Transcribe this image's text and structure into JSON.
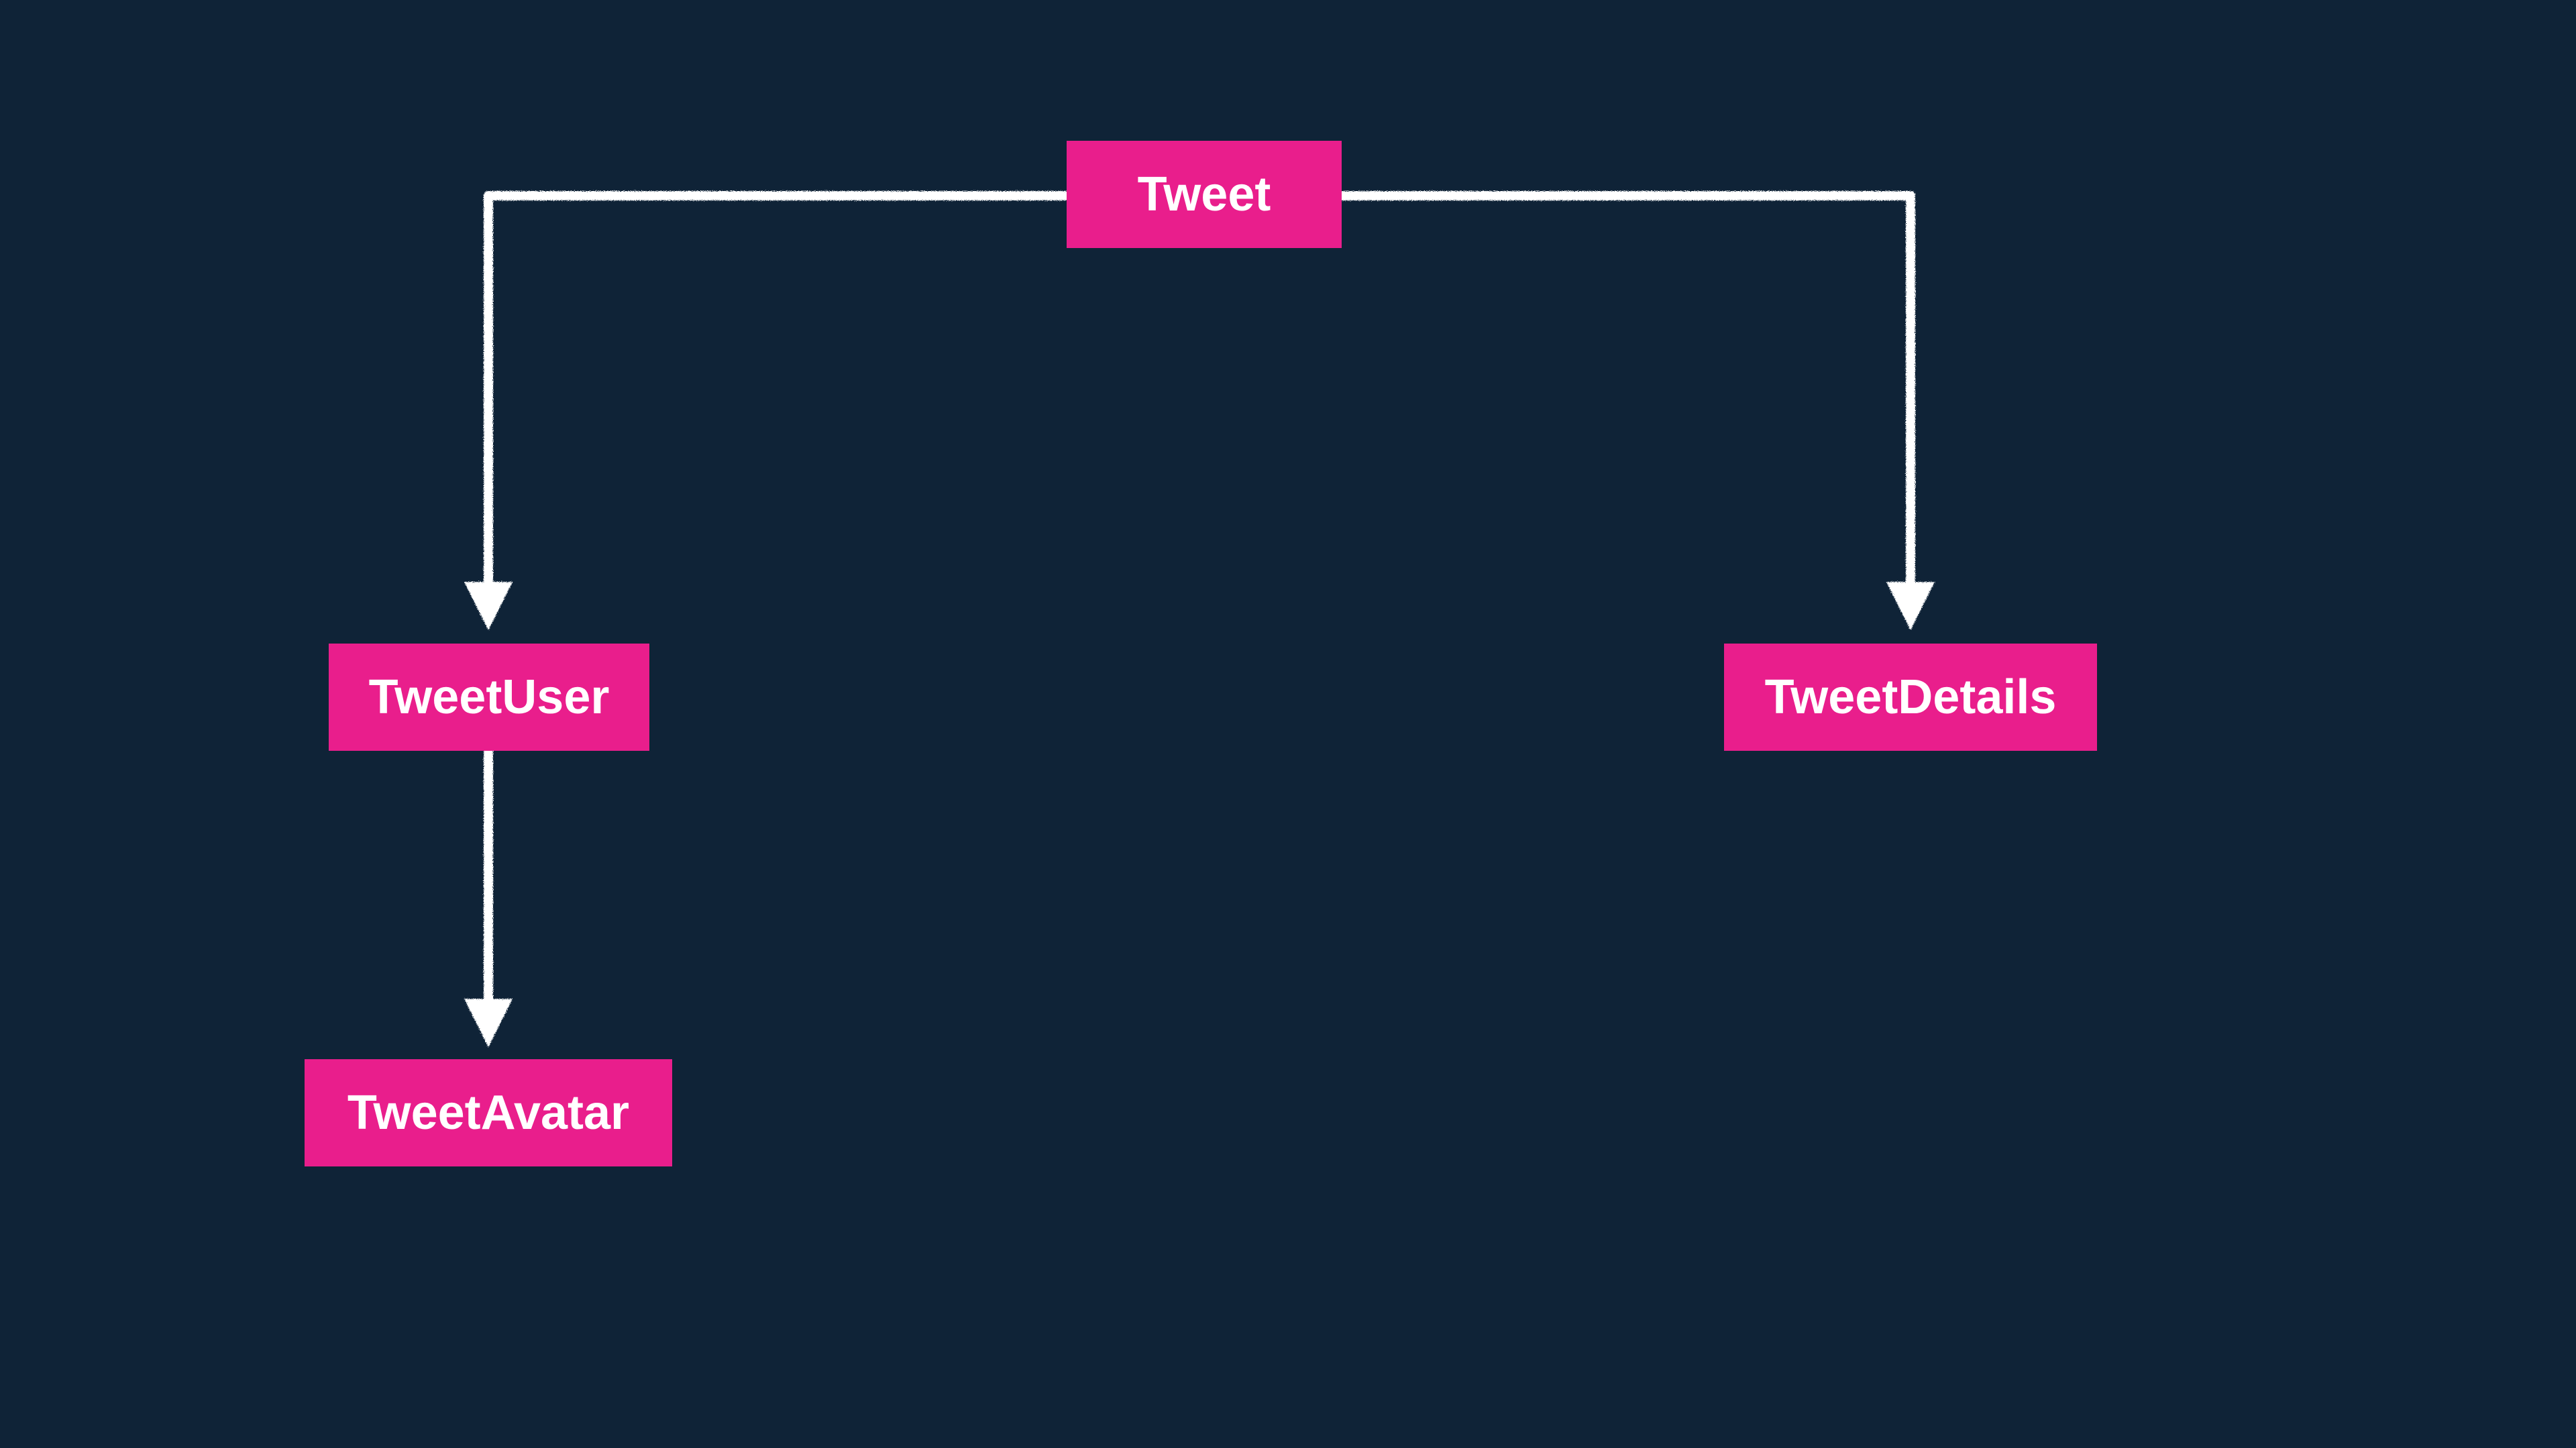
{
  "colors": {
    "background": "#0f2337",
    "node_fill": "#e91e8c",
    "node_text": "#ffffff",
    "line": "#ffffff"
  },
  "nodes": {
    "tweet": "Tweet",
    "tweet_user": "TweetUser",
    "tweet_details": "TweetDetails",
    "tweet_avatar": "TweetAvatar"
  },
  "edges": [
    {
      "from": "tweet",
      "to": "tweet_user"
    },
    {
      "from": "tweet",
      "to": "tweet_details"
    },
    {
      "from": "tweet_user",
      "to": "tweet_avatar"
    }
  ]
}
